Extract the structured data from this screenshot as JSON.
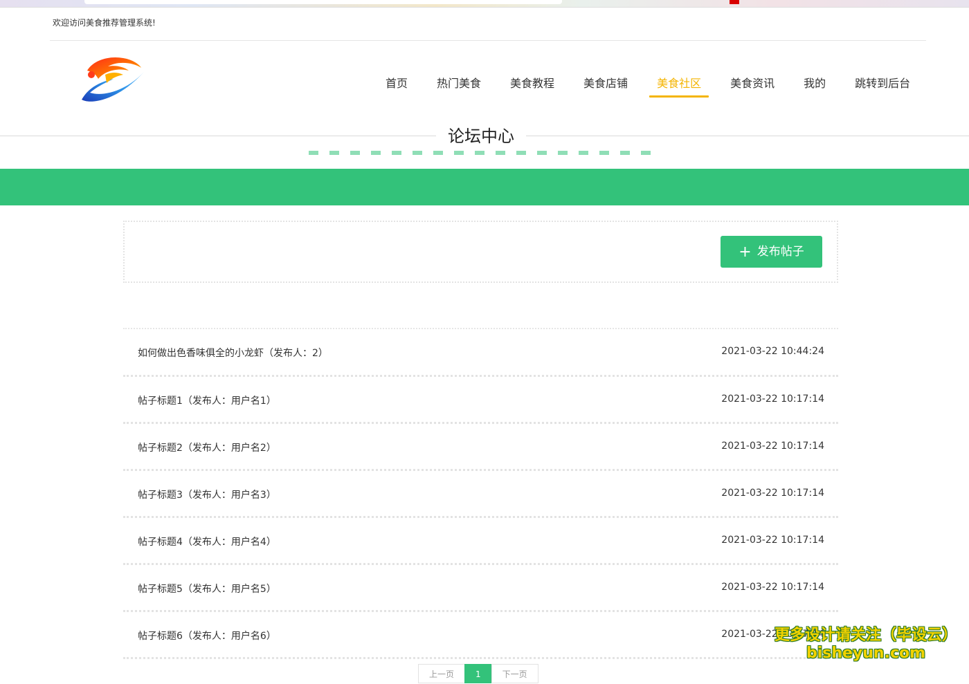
{
  "topbar": {
    "welcome": "欢迎访问美食推荐管理系统!"
  },
  "nav": {
    "items": [
      {
        "label": "首页",
        "active": false
      },
      {
        "label": "热门美食",
        "active": false
      },
      {
        "label": "美食教程",
        "active": false
      },
      {
        "label": "美食店铺",
        "active": false
      },
      {
        "label": "美食社区",
        "active": true
      },
      {
        "label": "美食资讯",
        "active": false
      },
      {
        "label": "我的",
        "active": false
      },
      {
        "label": "跳转到后台",
        "active": false
      }
    ]
  },
  "section": {
    "title": "论坛中心"
  },
  "toolbar": {
    "post_button": "发布帖子"
  },
  "posts": [
    {
      "title": "如何做出色香味俱全的小龙虾（发布人：2）",
      "time": "2021-03-22 10:44:24"
    },
    {
      "title": "帖子标题1（发布人：用户名1）",
      "time": "2021-03-22 10:17:14"
    },
    {
      "title": "帖子标题2（发布人：用户名2）",
      "time": "2021-03-22 10:17:14"
    },
    {
      "title": "帖子标题3（发布人：用户名3）",
      "time": "2021-03-22 10:17:14"
    },
    {
      "title": "帖子标题4（发布人：用户名4）",
      "time": "2021-03-22 10:17:14"
    },
    {
      "title": "帖子标题5（发布人：用户名5）",
      "time": "2021-03-22 10:17:14"
    },
    {
      "title": "帖子标题6（发布人：用户名6）",
      "time": "2021-03-22 10:17:14"
    }
  ],
  "pager": {
    "prev": "上一页",
    "current": "1",
    "next": "下一页"
  },
  "watermark": {
    "line1": "更多设计请关注（毕设云）",
    "line2": "bisheyun.com"
  },
  "colors": {
    "accent": "#33c27a",
    "active_nav": "#f4b400"
  }
}
